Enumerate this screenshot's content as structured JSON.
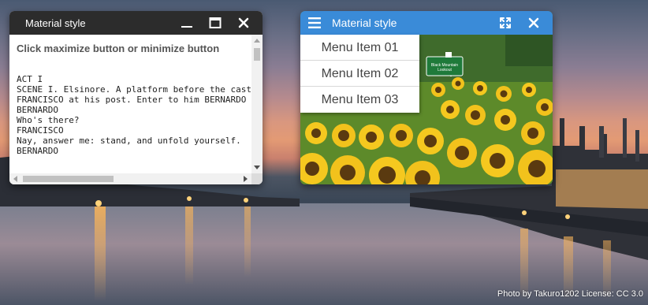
{
  "background": {
    "credit": "Photo by Takuro1202 License: CC 3.0"
  },
  "window_text": {
    "title": "Material style",
    "description": "Click maximize button or minimize button",
    "script_lines": [
      "ACT I",
      "SCENE I. Elsinore. A platform before the castle.",
      "FRANCISCO at his post. Enter to him BERNARDO",
      "BERNARDO",
      "Who's there?",
      "FRANCISCO",
      "Nay, answer me: stand, and unfold yourself.",
      "BERNARDO"
    ],
    "icons": [
      "minimize-icon",
      "maximize-icon",
      "close-icon"
    ],
    "titlebar_color": "#2c2c2c"
  },
  "window_menu": {
    "title": "Material style",
    "icons": [
      "hamburger-icon",
      "fullscreen-icon",
      "close-icon"
    ],
    "titlebar_color": "#3a8bd8",
    "menu_items": [
      "Menu Item 01",
      "Menu Item 02",
      "Menu Item 03"
    ],
    "sign": {
      "line1": "Black Mountain",
      "line2": "Lookout"
    }
  }
}
